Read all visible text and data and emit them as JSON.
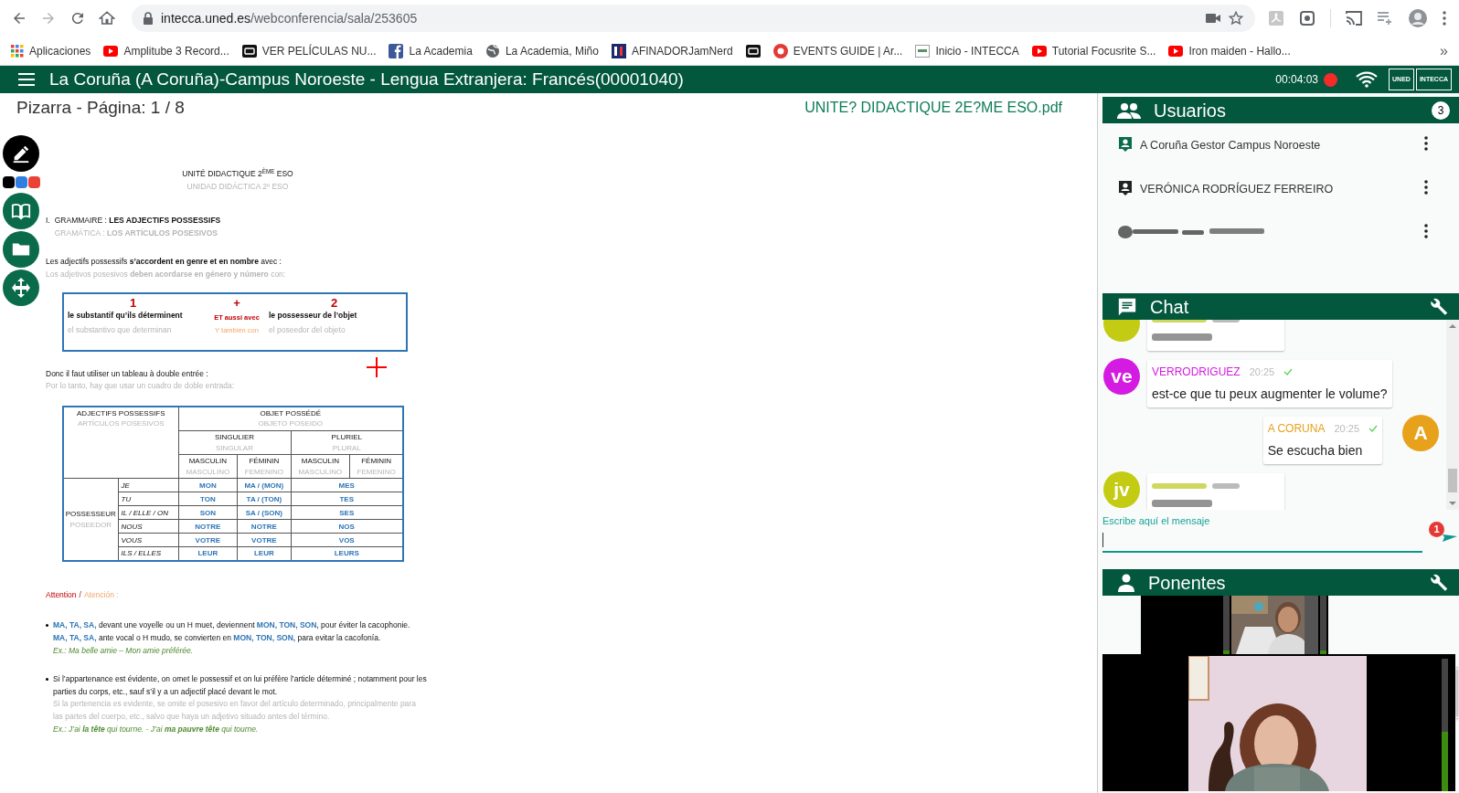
{
  "browser": {
    "url_host": "intecca.uned.es",
    "url_path": "/webconferencia/sala/253605",
    "bookmarks": [
      {
        "kind": "apps",
        "label": "Aplicaciones"
      },
      {
        "kind": "play",
        "label": "Amplitube 3 Record..."
      },
      {
        "kind": "dark",
        "label": "VER PELÍCULAS NU..."
      },
      {
        "kind": "blue",
        "label": "La Academia"
      },
      {
        "kind": "globe",
        "label": "La Academia, Miño"
      },
      {
        "kind": "navy",
        "label": "AFINADORJamNerd"
      },
      {
        "kind": "dark"
      },
      {
        "kind": "red",
        "label": "EVENTS GUIDE | Ar..."
      },
      {
        "kind": "light",
        "label": "Inicio - INTECCA"
      },
      {
        "kind": "play",
        "label": "Tutorial Focusrite S..."
      },
      {
        "kind": "play",
        "label": "Iron maiden - Hallo..."
      }
    ],
    "overflow": "»"
  },
  "header": {
    "title": "La Coruña (A Coruña)-Campus Noroeste - Lengua Extranjera: Francés(00001040)",
    "timer": "00:04:03",
    "recording": true,
    "logos": [
      "UNED",
      "INTECCA"
    ]
  },
  "whiteboard": {
    "title": "Pizarra - Página: 1 / 8",
    "file": "UNITE? DIDACTIQUE 2E?ME ESO.pdf",
    "tools": [
      {
        "kind": "pen",
        "selected": true
      },
      {
        "kind": "book",
        "selected": false
      },
      {
        "kind": "folder",
        "selected": false
      },
      {
        "kind": "move",
        "selected": false
      }
    ],
    "pen_colors": [
      {
        "color": "#000000"
      },
      {
        "color": "#2f7fe0"
      },
      {
        "color": "#ea4335"
      }
    ],
    "annotations": [
      {
        "kind": "cross"
      }
    ],
    "document": {
      "title": "UNITÉ DIDACTIQUE 2$^{ÈME}$ ESO",
      "subtitle": "UNIDAD DIDÁCTICA 2º ESO",
      "section_number": "I.",
      "section": "GRAMMAIRE : **LES ADJECTIFS POSSESSIFS**",
      "section_es": "GRAMÁTICA : **LOS ARTÍCULOS POSESIVOS**",
      "intro": "Les adjectifs possessifs **s’accordent en genre et en nombre** avec :",
      "intro_es": "Los adjetivos posesivos **deben acordarse en género y número** con:",
      "box": {
        "left": {
          "number": "1",
          "fr": "le substantif qu’ils déterminent",
          "es": "el substantivo que determinan"
        },
        "middle": {
          "sign": "+",
          "fr": "ET aussi avec",
          "es": "Y también con"
        },
        "right": {
          "number": "2",
          "fr": "le possesseur de l’objet",
          "es": "el poseedor del objeto"
        }
      },
      "lead": "Donc il faut utiliser un tableau à double entrée :",
      "lead_es": "Por lo tanto, hay que usar un cuadro de doble entrada:",
      "table": {
        "corner": {
          "fr": "ADJECTIFS POSSESSIFS",
          "es": "ARTÍCULOS POSESIVOS"
        },
        "top": {
          "fr": "OBJET POSSÉDÉ",
          "es": "OBJETO POSEIDO"
        },
        "numbers": [
          {
            "fr": "SINGULIER",
            "es": "SINGULAR"
          },
          {
            "fr": "PLURIEL",
            "es": "PLURAL"
          }
        ],
        "genders": [
          {
            "fr": "MASCULIN",
            "es": "MASCULINO"
          },
          {
            "fr": "FÉMININ",
            "es": "FEMENINO"
          },
          {
            "fr": "MASCULIN",
            "es": "MASCULINO"
          },
          {
            "fr": "FÉMININ",
            "es": "FEMENINO"
          }
        ],
        "row_header": {
          "fr": "POSSESSEUR",
          "es": "POSEEDOR"
        },
        "rows": [
          {
            "pronoun": "JE",
            "masculine": "MON",
            "feminine": "MA / (MON)",
            "plural": "MES"
          },
          {
            "pronoun": "TU",
            "masculine": "TON",
            "feminine": "TA / (TON)",
            "plural": "TES"
          },
          {
            "pronoun": "IL / ELLE / ON",
            "masculine": "SON",
            "feminine": "SA / (SON)",
            "plural": "SES"
          },
          {
            "pronoun": "NOUS",
            "masculine": "NOTRE",
            "feminine": "NOTRE",
            "plural": "NOS"
          },
          {
            "pronoun": "VOUS",
            "masculine": "VOTRE",
            "feminine": "VOTRE",
            "plural": "VOS"
          },
          {
            "pronoun": "ILS / ELLES",
            "masculine": "LEUR",
            "feminine": "LEUR",
            "plural": "LEURS"
          }
        ]
      },
      "attention": "Attention",
      "attention_sep": "/",
      "attention_es": "Atención :",
      "bullets": [
        {
          "lines": [
            {
              "kind": "dark",
              "text": "**MA, TA, SA,** devant une voyelle ou un H muet, deviennent **MON, TON, SON,** pour éviter la cacophonie."
            },
            {
              "kind": "dark",
              "text": "**MA, TA, SA,** ante vocal o H mudo, se convierten en **MON, TON, SON,** para evitar la cacofonía."
            },
            {
              "kind": "example",
              "text": "Ex.: Ma belle amie – Mon amie préférée."
            }
          ]
        },
        {
          "lines": [
            {
              "kind": "dark",
              "text": "Si l’appartenance est évidente, on omet le possessif et on lui préfère l’article déterminé ; notamment pour les parties du corps, etc., sauf s’il y a un adjectif placé devant le mot."
            },
            {
              "kind": "gray",
              "text": "Si la pertenencia es evidente, se omite el posesivo en favor del artículo determinado, principalmente para las partes del cuerpo, etc., salvo que haya un adjetivo situado antes del término."
            },
            {
              "kind": "example",
              "text": "Ex.: J’ai **la tête** qui tourne. - J’ai **ma pauvre tête** qui tourne."
            }
          ]
        }
      ]
    }
  },
  "users": {
    "title": "Usuarios",
    "count": "3",
    "items": [
      {
        "kind": "named",
        "color": "#0b6b4b",
        "name": "A Coruña Gestor Campus Noroeste"
      },
      {
        "kind": "named",
        "color": "#222222",
        "name": "VERÓNICA RODRÍGUEZ FERREIRO"
      },
      {
        "kind": "blurred"
      }
    ]
  },
  "chat": {
    "title": "Chat",
    "messages": [
      {
        "kind": "blurred",
        "own": false,
        "color": "#c3cc12"
      },
      {
        "kind": "text",
        "own": false,
        "avatar": "ve",
        "color": "#d41be2",
        "author": "VERRODRIGUEZ",
        "time": "20:25",
        "delivered": true,
        "text": "est-ce que tu peux augmenter le volume?"
      },
      {
        "kind": "text",
        "own": true,
        "avatar": "A",
        "color": "#e8a11a",
        "author": "A CORUNA",
        "time": "20:25",
        "delivered": true,
        "text": "Se escucha bien"
      },
      {
        "kind": "blurred",
        "own": false,
        "avatar": "jv",
        "color": "#c3cc12"
      }
    ],
    "input_label": "Escribe aquí el mensaje",
    "unread": "1"
  },
  "speakers": {
    "title": "Ponentes",
    "videos": [
      {
        "kind": "picture",
        "level": 0.06
      },
      {
        "kind": "picture",
        "level": 0.45
      }
    ]
  }
}
